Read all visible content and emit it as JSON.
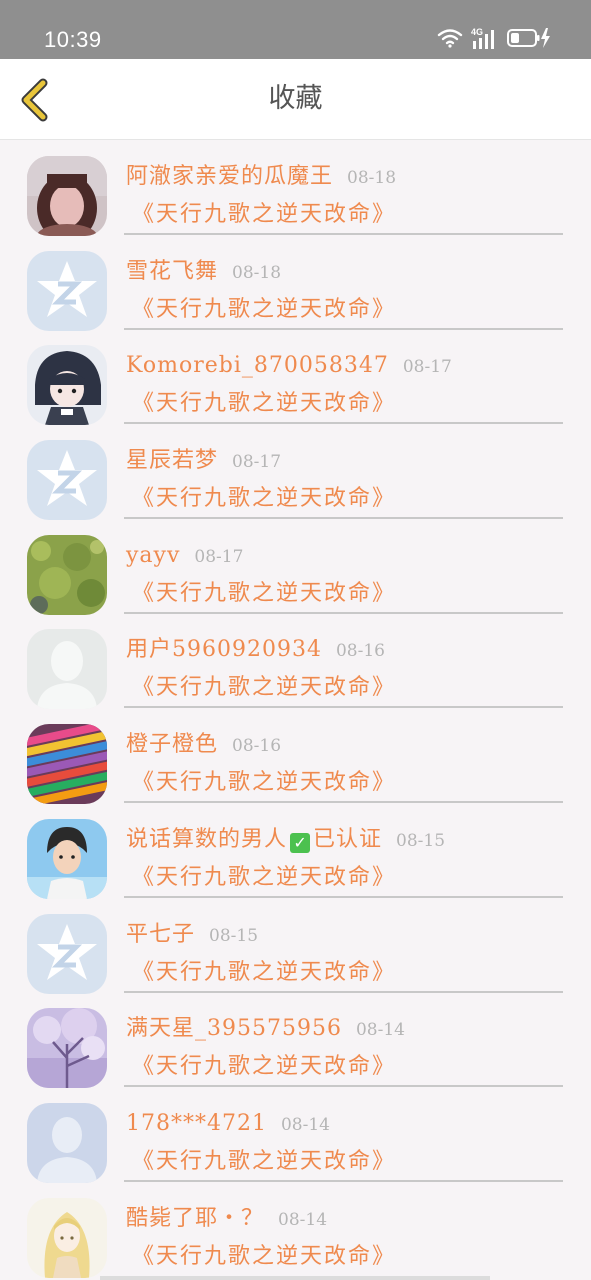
{
  "status_bar": {
    "time": "10:39",
    "network": "4G"
  },
  "header": {
    "title": "收藏",
    "back_icon": "chevron-left-icon",
    "accent_color": "#e8c53a"
  },
  "items": [
    {
      "name": "阿澈家亲爱的瓜魔王",
      "date": "08-18",
      "book": "《天行九歌之逆天改命》",
      "avatar": "photo-girl"
    },
    {
      "name": "雪花飞舞",
      "date": "08-18",
      "book": "《天行九歌之逆天改命》",
      "avatar": "default-qq"
    },
    {
      "name": "Komorebi_870058347",
      "date": "08-17",
      "book": "《天行九歌之逆天改命》",
      "avatar": "anime-character"
    },
    {
      "name": "星辰若梦",
      "date": "08-17",
      "book": "《天行九歌之逆天改命》",
      "avatar": "default-qq"
    },
    {
      "name": "yayv",
      "date": "08-17",
      "book": "《天行九歌之逆天改命》",
      "avatar": "green-field"
    },
    {
      "name": "用户5960920934",
      "date": "08-16",
      "book": "《天行九歌之逆天改命》",
      "avatar": "default-silhouette-light"
    },
    {
      "name": "橙子橙色",
      "date": "08-16",
      "book": "《天行九歌之逆天改命》",
      "avatar": "colored-pencils"
    },
    {
      "name": "说话算数的男人",
      "verified": "已认证",
      "date": "08-15",
      "book": "《天行九歌之逆天改命》",
      "avatar": "cartoon-man"
    },
    {
      "name": "平七子",
      "date": "08-15",
      "book": "《天行九歌之逆天改命》",
      "avatar": "default-qq"
    },
    {
      "name": "满天星_395575956",
      "date": "08-14",
      "book": "《天行九歌之逆天改命》",
      "avatar": "purple-tree"
    },
    {
      "name": "178***4721",
      "date": "08-14",
      "book": "《天行九歌之逆天改命》",
      "avatar": "default-silhouette-blue"
    },
    {
      "name": "酷毙了耶・？",
      "date": "08-14",
      "book": "《天行九歌之逆天改命》",
      "avatar": "anime-blonde"
    }
  ]
}
